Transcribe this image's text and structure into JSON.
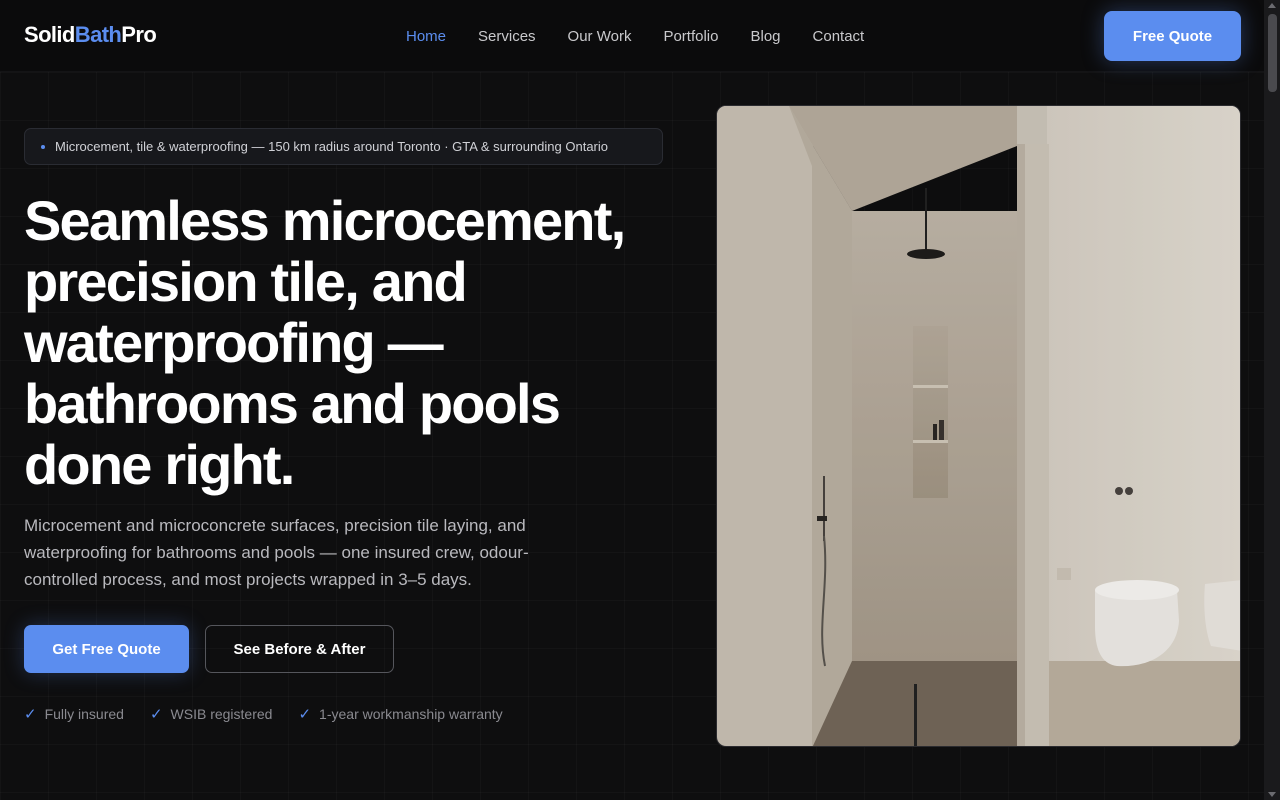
{
  "brand": {
    "name_part1": "Solid",
    "name_part2": "Bath",
    "name_part3": "Pro",
    "accent_color": "#5b8def"
  },
  "nav": {
    "links": [
      "Home",
      "Services",
      "Our Work",
      "Portfolio",
      "Blog",
      "Contact"
    ],
    "active": "Home",
    "cta_label": "Free Quote"
  },
  "hero": {
    "badge_text": "Microcement, tile & waterproofing — 150 km radius around Toronto · GTA & surrounding Ontario",
    "headline": "Seamless microcement, precision tile, and waterproofing — bathrooms and pools done right.",
    "subcopy": "Microcement and microconcrete surfaces, precision tile laying, and waterproofing for bathrooms and pools — one insured crew, odour-controlled process, and most projects wrapped in 3–5 days.",
    "primary_cta": "Get Free Quote",
    "secondary_cta": "See Before & After",
    "trust_items": [
      "Fully insured",
      "WSIB registered",
      "1-year workmanship warranty"
    ],
    "check_glyph": "✓"
  },
  "icons": {
    "badge_dot": "dot-icon",
    "trust": "checkmark-icon"
  }
}
